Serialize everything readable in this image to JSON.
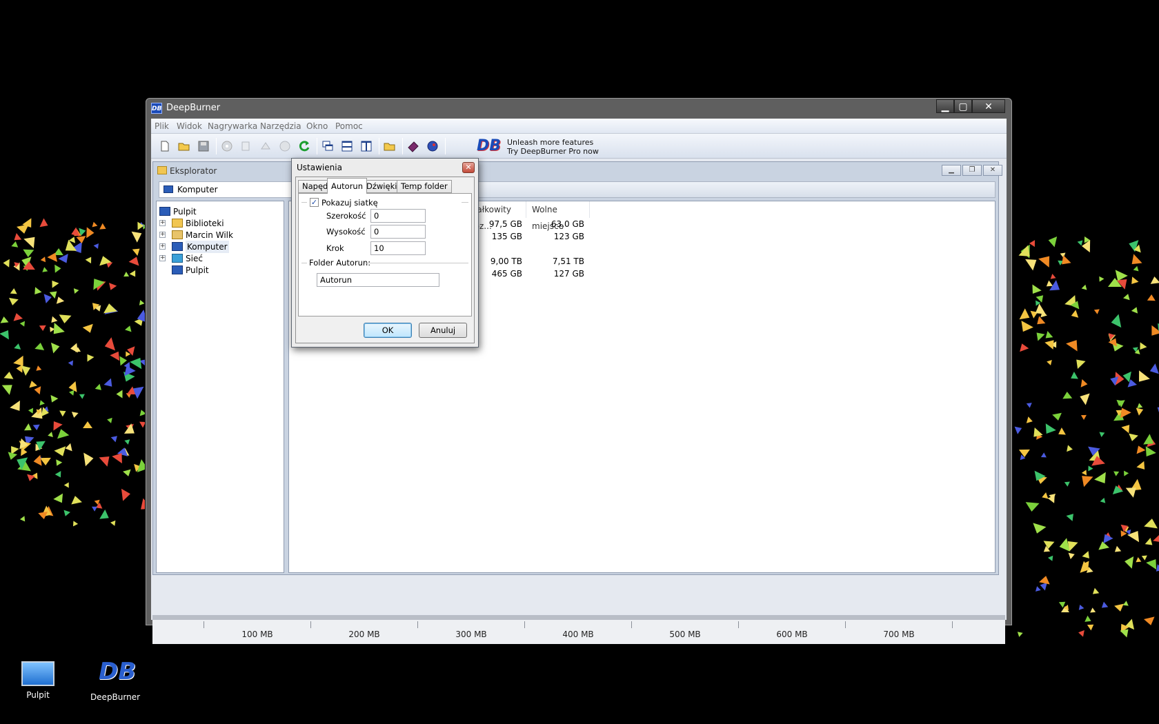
{
  "desktop": {
    "icons": [
      {
        "label": "Pulpit"
      },
      {
        "label": "DeepBurner"
      }
    ]
  },
  "window": {
    "title": "DeepBurner",
    "app_icon_text": "DB",
    "controls": {
      "minimize": "▁",
      "maximize": "▢",
      "close": "✕"
    }
  },
  "menu": [
    "Plik",
    "Widok",
    "Nagrywarka",
    "Narzędzia",
    "Okno",
    "Pomoc"
  ],
  "toolbar": {
    "icons": [
      "new-icon",
      "open-icon",
      "save-icon",
      "burn-icon",
      "copy-icon",
      "erase-icon",
      "disc-info-icon",
      "refresh-icon",
      "cascade-icon",
      "tile-horizontal-icon",
      "tile-vertical-icon",
      "folder-open-icon",
      "book-icon",
      "globe-icon"
    ],
    "promo_logo": "DB",
    "promo_line1": "Unleash more features",
    "promo_line2": "Try DeepBurner Pro now"
  },
  "explorer": {
    "title": "Eksplorator",
    "address": "Komputer",
    "tree": [
      {
        "label": "Pulpit",
        "expandable": false,
        "level": 0
      },
      {
        "label": "Biblioteki",
        "expandable": true,
        "level": 1
      },
      {
        "label": "Marcin Wilk",
        "expandable": true,
        "level": 1
      },
      {
        "label": "Komputer",
        "expandable": true,
        "level": 1
      },
      {
        "label": "Sieć",
        "expandable": true,
        "level": 1
      },
      {
        "label": "Pulpit",
        "expandable": false,
        "level": 1
      }
    ],
    "columns": [
      "Całkowity roz...",
      "Wolne miejsce"
    ],
    "rows": [
      {
        "total": "97,5 GB",
        "free": "63,0 GB"
      },
      {
        "total": "135 GB",
        "free": "123 GB"
      },
      {
        "total": "",
        "free": ""
      },
      {
        "total": "9,00 TB",
        "free": "7,51 TB"
      },
      {
        "total": "465 GB",
        "free": "127 GB"
      }
    ]
  },
  "capacity_bar": {
    "labels": [
      "100 MB",
      "200 MB",
      "300 MB",
      "400 MB",
      "500 MB",
      "600 MB",
      "700 MB"
    ]
  },
  "dialog": {
    "title": "Ustawienia",
    "close": "✕",
    "tabs": [
      "Napęd",
      "Autorun",
      "Dźwięki",
      "Temp folder"
    ],
    "active_tab": "Autorun",
    "show_grid_label": "Pokazuj siatkę",
    "show_grid_checked": true,
    "width_label": "Szerokość",
    "width_value": "0",
    "height_label": "Wysokość",
    "height_value": "0",
    "step_label": "Krok",
    "step_value": "10",
    "folder_group_label": "Folder Autorun:",
    "folder_value": "Autorun",
    "ok_label": "OK",
    "cancel_label": "Anuluj"
  }
}
